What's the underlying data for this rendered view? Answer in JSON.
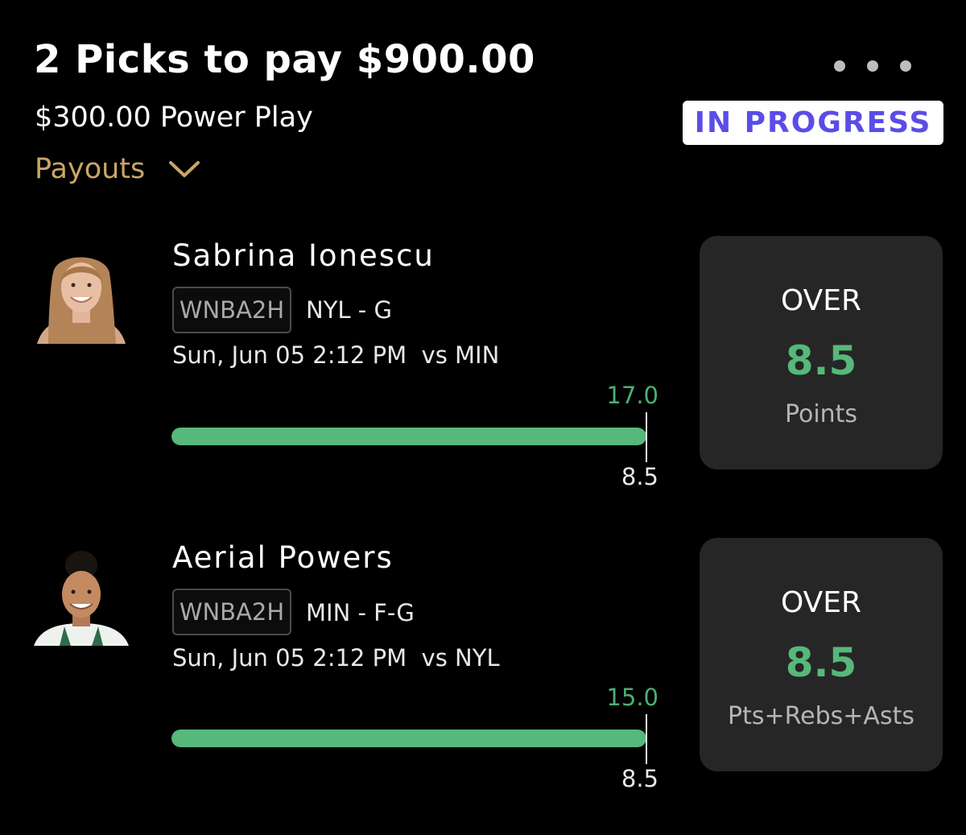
{
  "header": {
    "title": "2 Picks to pay $900.00",
    "subtitle": "$300.00 Power Play",
    "payouts_label": "Payouts",
    "status": "IN PROGRESS"
  },
  "colors": {
    "background": "#000000",
    "accent_gold": "#c9a567",
    "status_text": "#5a4de6",
    "progress_green": "#56b87a",
    "card_background": "#262626"
  },
  "icons": {
    "more": "more-dots-icon",
    "payouts_toggle": "chevron-down-icon"
  },
  "picks": [
    {
      "player_name": "Sabrina Ionescu",
      "league": "WNBA2H",
      "team_position": "NYL - G",
      "game_info": "Sun, Jun 05 2:12 PM  vs MIN",
      "current_value": "17.0",
      "line_value": "8.5",
      "progress_fraction": 1.0,
      "direction": "OVER",
      "line": "8.5",
      "stat": "Points"
    },
    {
      "player_name": "Aerial Powers",
      "league": "WNBA2H",
      "team_position": "MIN - F-G",
      "game_info": "Sun, Jun 05 2:12 PM  vs NYL",
      "current_value": "15.0",
      "line_value": "8.5",
      "progress_fraction": 1.0,
      "direction": "OVER",
      "line": "8.5",
      "stat": "Pts+Rebs+Asts"
    }
  ]
}
